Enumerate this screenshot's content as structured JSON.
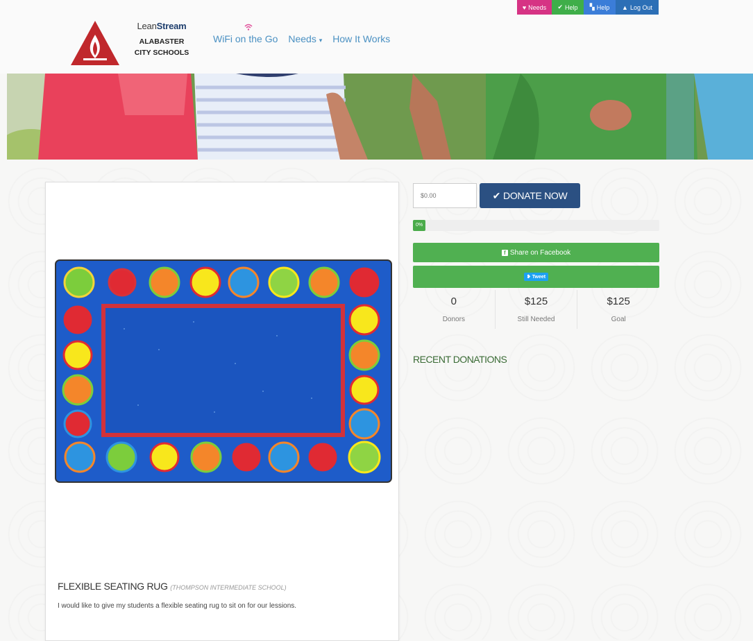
{
  "header": {
    "top_buttons": [
      {
        "label": "Needs",
        "icon": "heart-icon",
        "color": "#d63384"
      },
      {
        "label": "Help",
        "icon": "check-icon",
        "color": "#3fae49"
      },
      {
        "label": "Help",
        "icon": "bookmark-icon",
        "color": "#3b7dd8"
      },
      {
        "label": "Log Out",
        "icon": "user-icon",
        "color": "#2c6fb6"
      }
    ],
    "brand": {
      "lean": "Lean",
      "stream": "Stream",
      "school_line1": "ALABASTER",
      "school_line2": "CITY SCHOOLS"
    },
    "nav": [
      {
        "label": "WiFi on the Go"
      },
      {
        "label": "Needs",
        "dropdown": true
      },
      {
        "label": "How It Works"
      }
    ],
    "accent_color": "#4a90c2",
    "logo_color": "#c0282c"
  },
  "need": {
    "title": "FLEXIBLE SEATING RUG",
    "school": "(THOMPSON INTERMEDIATE SCHOOL)",
    "description": "I would like to give my students a flexible seating rug to sit on for our lessions.",
    "image": "flexible-seating-rug-image"
  },
  "donation": {
    "amount_placeholder": "$0.00",
    "donate_label": "DONATE NOW",
    "progress_label": "0%",
    "progress_fraction": 0,
    "facebook_label": "Share on Facebook",
    "tweet_label": "Tweet",
    "primary_color": "#2b5082",
    "share_color": "#50b051"
  },
  "stats": [
    {
      "value": "0",
      "label": "Donors"
    },
    {
      "value": "$125",
      "label": "Still Needed"
    },
    {
      "value": "$125",
      "label": "Goal"
    }
  ],
  "recent_donations": {
    "heading": "RECENT DONATIONS"
  }
}
